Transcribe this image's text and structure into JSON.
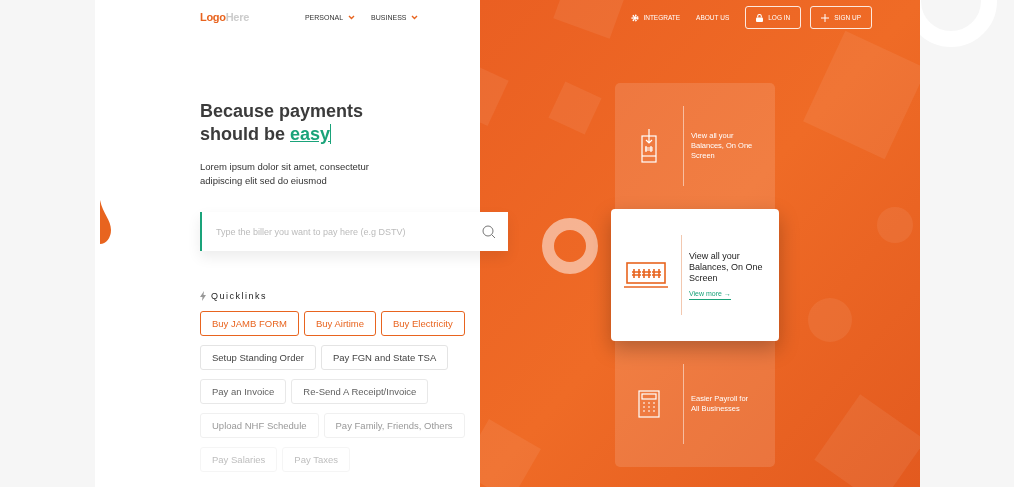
{
  "logo": {
    "primary": "Logo",
    "secondary": "Here"
  },
  "left_nav": [
    {
      "label": "PERSONAL"
    },
    {
      "label": "BUSINESS"
    }
  ],
  "right_nav": [
    {
      "label": "INTEGRATE",
      "kind": "link"
    },
    {
      "label": "ABOUT US",
      "kind": "link"
    },
    {
      "label": "LOG IN",
      "kind": "login"
    },
    {
      "label": "SIGN UP",
      "kind": "signup"
    }
  ],
  "hero": {
    "heading": "Because payments should be",
    "highlight": "easy",
    "text": "Lorem ipsum dolor sit amet, consectetur adipiscing elit sed do eiusmod"
  },
  "search": {
    "placeholder": "Type the biller you want to pay here (e.g DSTV)"
  },
  "quicklinks": {
    "title": "Quicklinks",
    "rows": [
      [
        {
          "label": "Buy JAMB FORM",
          "kind": "featured"
        },
        {
          "label": "Buy Airtime",
          "kind": "featured"
        },
        {
          "label": "Buy Electricity",
          "kind": "featured"
        }
      ],
      [
        {
          "label": "Setup Standing Order",
          "kind": "plain"
        },
        {
          "label": "Pay FGN and State TSA",
          "kind": "plain"
        }
      ],
      [
        {
          "label": "Pay an Invoice",
          "kind": "plain"
        },
        {
          "label": "Re-Send A Receipt/Invoice",
          "kind": "plain"
        }
      ],
      [
        {
          "label": "Upload NHF Schedule",
          "kind": "plain"
        },
        {
          "label": "Pay Family, Friends, Others",
          "kind": "plain"
        }
      ],
      [
        {
          "label": "Pay Salaries",
          "kind": "plain"
        },
        {
          "label": "Pay Taxes",
          "kind": "plain"
        }
      ]
    ]
  },
  "features": [
    {
      "kind": "deposit",
      "text": "View all your Balances, On One Screen",
      "selected": false
    },
    {
      "kind": "balances",
      "text": "View all your Balances, On One Screen",
      "selected": true,
      "link": "View more →"
    },
    {
      "kind": "payroll",
      "text": "Easier Payroll for All Businesses",
      "selected": false
    }
  ]
}
